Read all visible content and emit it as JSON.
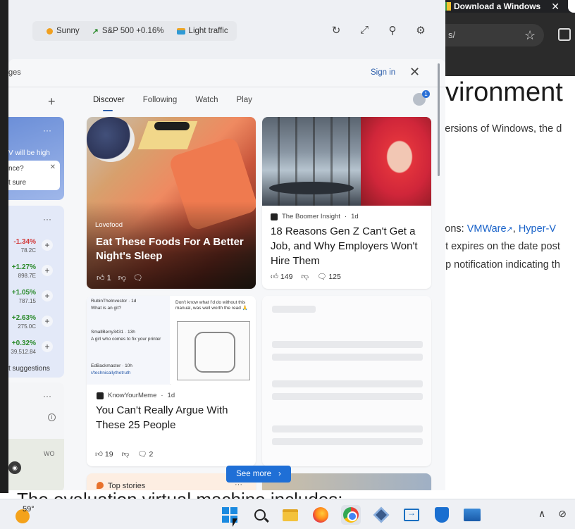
{
  "background_browser": {
    "tab_title": "Download a Windows",
    "tab_close": "✕",
    "url_fragment": "s/",
    "heading": "vironment",
    "line1": "versions of Windows, the d",
    "line2_prefix": "tions: ",
    "link_vmware": "VMWare",
    "link_sep": ", ",
    "link_hyperv": "Hyper-V",
    "line3": "at expires on the date post",
    "line4": "op notification indicating th",
    "bottom_text": "The evaluation virtual machine includes:"
  },
  "widgets": {
    "topbar_chips": [
      {
        "label": "Sunny",
        "icon": "sun-icon"
      },
      {
        "label": "S&P 500 +0.16%",
        "icon": "trend-up-icon"
      },
      {
        "label": "Light traffic",
        "icon": "traffic-icon"
      }
    ],
    "top_actions": [
      "refresh-icon",
      "expand-icon",
      "pin-icon",
      "settings-icon"
    ],
    "feed_header": {
      "pages_label": "ges",
      "sign_in": "Sign in",
      "close": "✕"
    },
    "add_label": "+",
    "tabs": [
      {
        "label": "Discover",
        "active": true
      },
      {
        "label": "Following",
        "active": false
      },
      {
        "label": "Watch",
        "active": false
      },
      {
        "label": "Play",
        "active": false
      }
    ],
    "avatar_badge": "1",
    "weather_card": {
      "menu": "···",
      "partial_text": "V will be high",
      "question": "nce?",
      "answer": "t sure"
    },
    "stocks_card": {
      "menu": "···",
      "items": [
        {
          "pct": "-1.34%",
          "value": "78.2C",
          "direction": "down"
        },
        {
          "pct": "+1.27%",
          "value": "898.7E",
          "direction": "up"
        },
        {
          "pct": "+1.05%",
          "value": "787.15",
          "direction": "up"
        },
        {
          "pct": "+2.63%",
          "value": "275.0C",
          "direction": "up"
        },
        {
          "pct": "+0.32%",
          "value": "39,512.84",
          "direction": "up"
        }
      ],
      "suggestions": "t suggestions"
    },
    "map_card": {
      "menu": "···",
      "map_label": "WO"
    },
    "articles": [
      {
        "source": "Lovefood",
        "title": "Eat These Foods For A Better Night's Sleep",
        "likes": "1"
      },
      {
        "source": "The Boomer Insight",
        "age": "1d",
        "title": "18 Reasons Gen Z Can't Get a Job, and Why Employers Won't Hire Them",
        "likes": "149",
        "comments": "125"
      },
      {
        "source": "KnowYourMeme",
        "age": "1d",
        "title": "You Can't Really Argue With These 25 People",
        "likes": "19",
        "comments": "2",
        "meme": {
          "post1_user": "RubinTheInvestor",
          "post1_age": "1d",
          "post1_text": "What is an git?",
          "post2_user": "SmallBerry3431",
          "post2_age": "13h",
          "post2_text": "A girl who comes to fix your printer",
          "post3_user": "EdBackmaster",
          "post3_age": "10h",
          "post3_link": "r/technicallythetruth",
          "right_text": "Don't know what I'd do without this manual, was well worth the read 🙏"
        }
      }
    ],
    "top_stories": "Top stories",
    "top_stories_menu": "···",
    "see_more": "See more",
    "see_more_chevron": "›"
  },
  "taskbar": {
    "temperature": "59°",
    "apps": [
      "start-icon",
      "search-icon",
      "file-explorer-icon",
      "firefox-icon",
      "chrome-icon",
      "virtualbox-icon",
      "remote-desktop-icon",
      "defender-icon",
      "photos-icon"
    ],
    "tray_chevron": "∧",
    "tray_icon": "network-icon"
  },
  "colors": {
    "accent": "#1f6fd6",
    "positive": "#2a8a2a",
    "negative": "#d23a3a",
    "link": "#1a63c9"
  }
}
